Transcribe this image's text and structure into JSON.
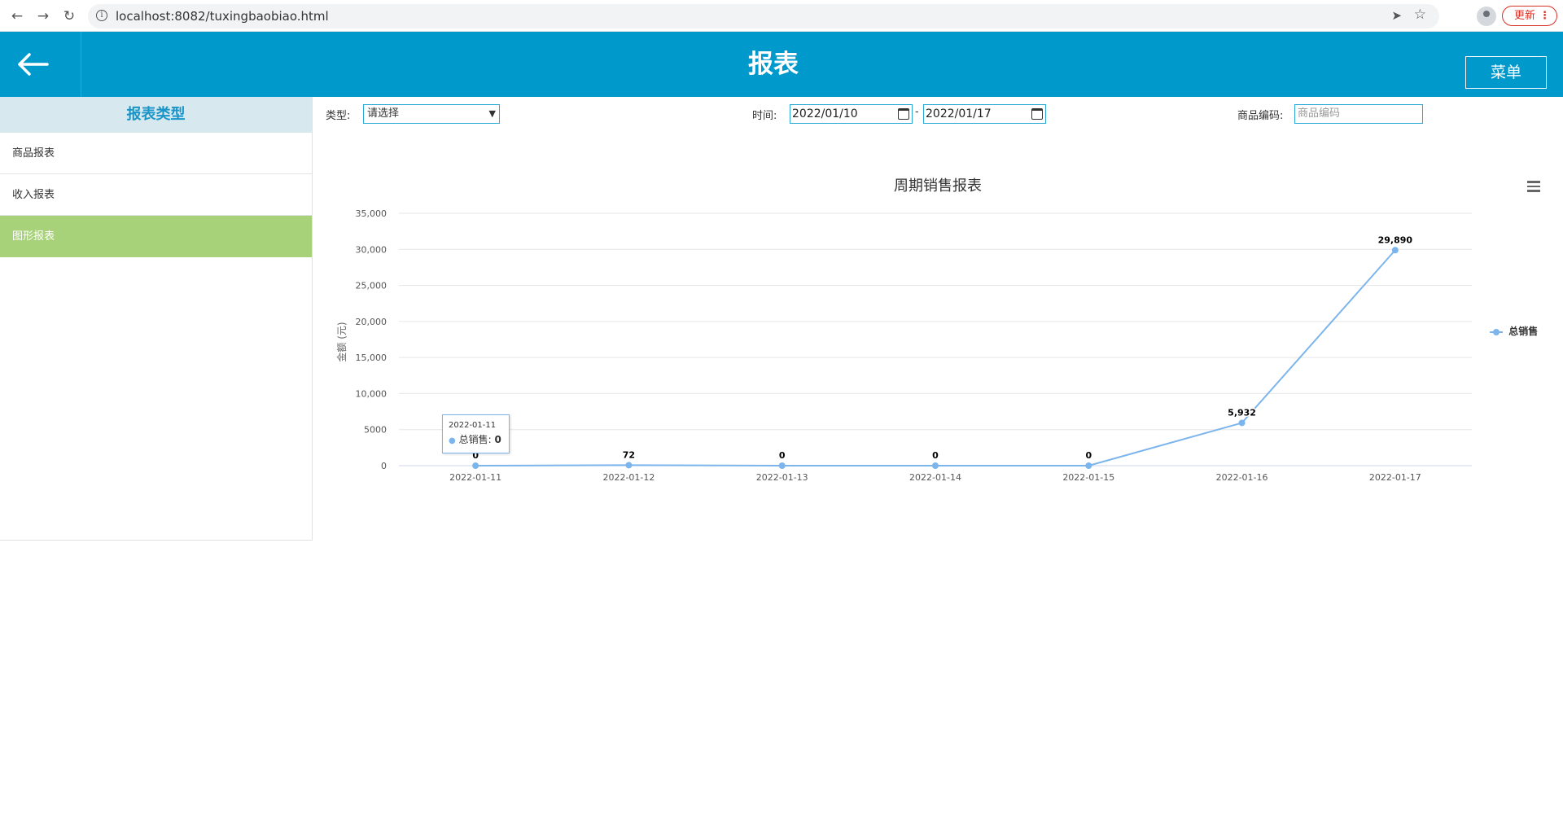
{
  "browser": {
    "url": "localhost:8082/tuxingbaobiao.html",
    "update_label": "更新"
  },
  "header": {
    "title": "报表",
    "menu_label": "菜单"
  },
  "sidebar": {
    "title": "报表类型",
    "items": [
      {
        "label": "商品报表",
        "active": false
      },
      {
        "label": "收入报表",
        "active": false
      },
      {
        "label": "图形报表",
        "active": true
      }
    ]
  },
  "filters": {
    "type_label": "类型:",
    "type_value": "请选择",
    "time_label": "时间:",
    "start_date": "2022/01/10",
    "end_date": "2022/01/17",
    "date_separator": "-",
    "code_label": "商品编码:",
    "code_placeholder": "商品编码"
  },
  "chart_data": {
    "type": "line",
    "title": "周期销售报表",
    "ylabel": "金额 (元)",
    "xlabel": "",
    "categories": [
      "2022-01-11",
      "2022-01-12",
      "2022-01-13",
      "2022-01-14",
      "2022-01-15",
      "2022-01-16",
      "2022-01-17"
    ],
    "series": [
      {
        "name": "总销售",
        "values": [
          0,
          72,
          0,
          0,
          0,
          5932,
          29890
        ],
        "color": "#7cb5ec"
      }
    ],
    "data_labels": [
      "0",
      "72",
      "0",
      "0",
      "0",
      "5,932",
      "29,890"
    ],
    "ylim": [
      0,
      35000
    ],
    "yticks": [
      0,
      5000,
      10000,
      15000,
      20000,
      25000,
      30000,
      35000
    ],
    "ytick_labels": [
      "0",
      "5000",
      "10,000",
      "15,000",
      "20,000",
      "25,000",
      "30,000",
      "35,000"
    ],
    "grid": true,
    "legend_position": "right",
    "tooltip": {
      "date": "2022-01-11",
      "series": "总销售",
      "value": "0"
    }
  }
}
